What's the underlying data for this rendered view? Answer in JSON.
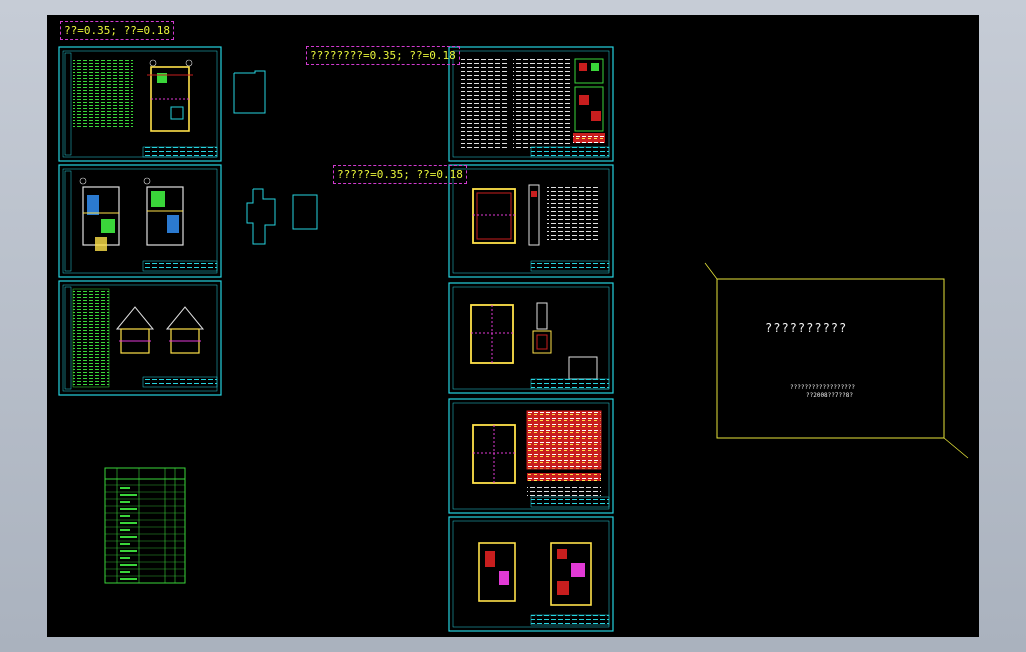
{
  "notes": {
    "note_1": "??=0.35;  ??=0.18",
    "note_2": "????????=0.35;  ??=0.18",
    "note_3": "?????=0.35;  ??=0.18"
  },
  "cover": {
    "title": "??????????",
    "line_1": "??????????????????",
    "line_2": "??2008??7??8?"
  },
  "colors": {
    "background": "#000000",
    "sheet_frame": "#26d3df",
    "note_border": "#d23bd0",
    "note_text": "#e8f53b",
    "cover_frame": "#e7e53a",
    "index_table": "#3ad63a"
  }
}
